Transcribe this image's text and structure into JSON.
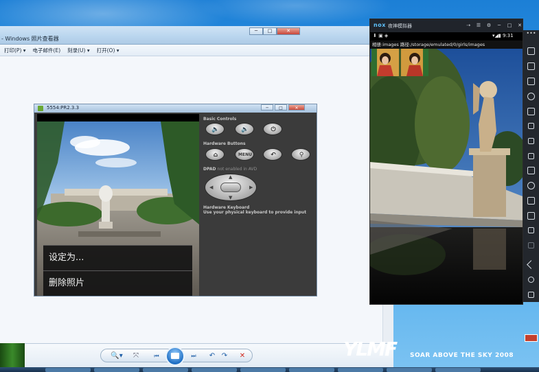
{
  "photo_viewer": {
    "title": "- Windows 照片查看器",
    "window_controls": {
      "minimize": "─",
      "maximize": "□",
      "close": "✕"
    },
    "menu": [
      {
        "label": "打印(P)",
        "arrow": "▾"
      },
      {
        "label": "电子邮件(E)",
        "arrow": ""
      },
      {
        "label": "刻录(U)",
        "arrow": "▾"
      },
      {
        "label": "打开(O)",
        "arrow": "▾"
      }
    ],
    "toolbar": {
      "zoom": "🔍▾",
      "fit": "⤧",
      "prev": "⏮",
      "next": "⏭",
      "rotate_ccw": "↶",
      "rotate_cw": "↷",
      "delete": "✕"
    }
  },
  "emulator": {
    "title": "5554:PR2.3.3",
    "window_controls": {
      "minimize": "─",
      "maximize": "□",
      "close": "✕"
    },
    "context_menu": [
      "设定为...",
      "删除照片"
    ],
    "panel": {
      "basic_controls": "Basic Controls",
      "hardware_buttons": "Hardware Buttons",
      "dpad_label": "DPAD",
      "dpad_note": "not enabled in AVD",
      "keyboard_title": "Hardware Keyboard",
      "keyboard_note": "Use your physical keyboard to provide input",
      "btn_volume_down": "🔈",
      "btn_volume_up": "🔊",
      "btn_power": "⏻",
      "btn_home": "⌂",
      "btn_menu": "MENU",
      "btn_back": "↶",
      "btn_search": "⚲"
    }
  },
  "nox": {
    "logo": "nox",
    "title": "夜神模拟器",
    "title_controls": [
      "⇢",
      "☰",
      "⚙",
      "─",
      "□",
      "✕"
    ],
    "status_left": "⬇ ▣ ◈",
    "status_right": "▾◢▮ 9:31",
    "path_bar": "相册:images    路径:/storage/emulated/0/girls/images",
    "side_top": "•••"
  },
  "branding": {
    "logo": "YLMF",
    "tagline": "SOAR ABOVE THE SKY 2008"
  }
}
